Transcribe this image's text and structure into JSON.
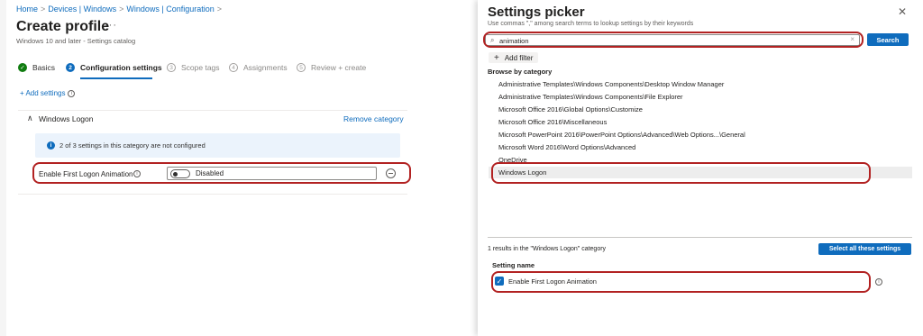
{
  "breadcrumb": {
    "items": [
      "Home",
      "Devices | Windows",
      "Windows | Configuration"
    ],
    "separator": ">"
  },
  "page": {
    "title": "Create profile",
    "more": "···",
    "subtitle": "Windows 10 and later - Settings catalog"
  },
  "wizard": {
    "steps": [
      {
        "number": "✓",
        "label": "Basics",
        "state": "done"
      },
      {
        "number": "2",
        "label": "Configuration settings",
        "state": "active"
      },
      {
        "number": "3",
        "label": "Scope tags",
        "state": "todo"
      },
      {
        "number": "4",
        "label": "Assignments",
        "state": "todo"
      },
      {
        "number": "5",
        "label": "Review + create",
        "state": "todo"
      }
    ]
  },
  "add_settings": "+ Add settings",
  "info_glyph": "i",
  "category": {
    "chevron": "∧",
    "name": "Windows Logon",
    "remove": "Remove category",
    "notice": "2 of 3 settings in this category are not configured",
    "setting": {
      "label": "Enable First Logon Animation",
      "value": "Disabled",
      "enabled": false
    }
  },
  "picker": {
    "title": "Settings picker",
    "close": "✕",
    "hint": "Use commas \",\" among search terms to lookup settings by their keywords",
    "search_value": "animation",
    "search_placeholder": "",
    "search_icon": "⌕",
    "clear": "×",
    "search_button": "Search",
    "add_filter": "Add filter",
    "add_filter_icon": "+",
    "browse_title": "Browse by category",
    "categories": [
      "Administrative Templates\\Windows Components\\Desktop Window Manager",
      "Administrative Templates\\Windows Components\\File Explorer",
      "Microsoft Office 2016\\Global Options\\Customize",
      "Microsoft Office 2016\\Miscellaneous",
      "Microsoft PowerPoint 2016\\PowerPoint Options\\Advanced\\Web Options...\\General",
      "Microsoft Word 2016\\Word Options\\Advanced",
      "OneDrive",
      "Windows Logon"
    ],
    "selected_category": "Windows Logon",
    "results_text": "1 results in the \"Windows Logon\" category",
    "select_all": "Select all these settings",
    "column_header": "Setting name",
    "results": [
      {
        "label": "Enable First Logon Animation",
        "checked": true
      }
    ],
    "check_glyph": "✓"
  },
  "colors": {
    "accent": "#0f6cbd",
    "success": "#107c10",
    "highlight_border": "#b22222",
    "info_background": "#ebf3fc"
  }
}
